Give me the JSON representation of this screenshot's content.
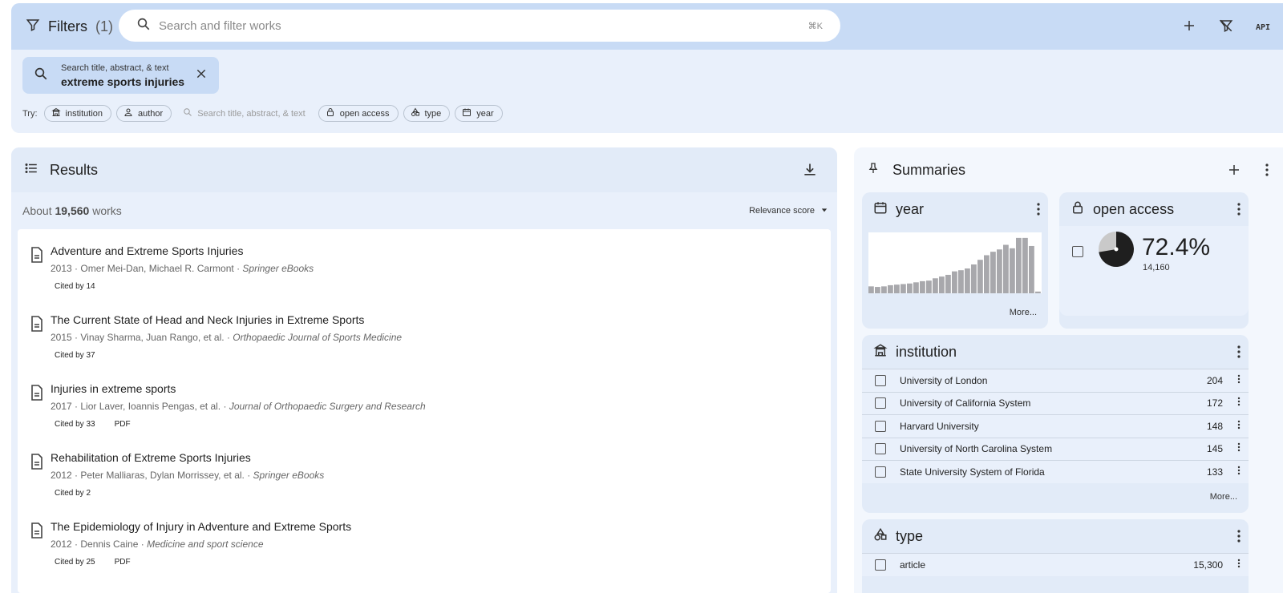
{
  "filters": {
    "title": "Filters",
    "count": "(1)",
    "search_placeholder": "Search and filter works",
    "shortcut": "⌘K",
    "api_label": "API",
    "active_chip": {
      "label": "Search title, abstract, & text",
      "value": "extreme sports injuries"
    },
    "try_label": "Try:",
    "try_chips": [
      "institution",
      "author",
      "Search title, abstract, & text",
      "open access",
      "type",
      "year"
    ]
  },
  "results": {
    "title": "Results",
    "about_prefix": "About",
    "about_count": "19,560",
    "about_suffix": "works",
    "sort_label": "Relevance score",
    "works": [
      {
        "title": "Adventure and Extreme Sports Injuries",
        "year_authors": "2013 · Omer Mei-Dan, Michael R. Carmont ·",
        "source": "Springer eBooks",
        "cited": "Cited by 14",
        "pdf": ""
      },
      {
        "title": "The Current State of Head and Neck Injuries in Extreme Sports",
        "year_authors": "2015 · Vinay Sharma, Juan Rango, et al. ·",
        "source": "Orthopaedic Journal of Sports Medicine",
        "cited": "Cited by 37",
        "pdf": ""
      },
      {
        "title": "Injuries in extreme sports",
        "year_authors": "2017 · Lior Laver, Ioannis Pengas, et al. ·",
        "source": "Journal of Orthopaedic Surgery and Research",
        "cited": "Cited by 33",
        "pdf": "PDF"
      },
      {
        "title": "Rehabilitation of Extreme Sports Injuries",
        "year_authors": "2012 · Peter Malliaras, Dylan Morrissey, et al. ·",
        "source": "Springer eBooks",
        "cited": "Cited by 2",
        "pdf": ""
      },
      {
        "title": "The Epidemiology of Injury in Adventure and Extreme Sports",
        "year_authors": "2012 · Dennis Caine ·",
        "source": "Medicine and sport science",
        "cited": "Cited by 25",
        "pdf": "PDF"
      }
    ]
  },
  "summaries": {
    "title": "Summaries",
    "year": {
      "title": "year",
      "more": "More...",
      "bar_levels": [
        0.12,
        0.11,
        0.12,
        0.14,
        0.15,
        0.16,
        0.17,
        0.19,
        0.21,
        0.22,
        0.26,
        0.29,
        0.32,
        0.38,
        0.4,
        0.43,
        0.5,
        0.58,
        0.66,
        0.72,
        0.76,
        0.84,
        0.78,
        0.96,
        0.96,
        0.82,
        0.03
      ]
    },
    "open_access": {
      "title": "open access",
      "percent": "72.4%",
      "count": "14,160",
      "fraction": 0.724
    },
    "institution": {
      "title": "institution",
      "more": "More...",
      "items": [
        {
          "name": "University of London",
          "count": "204"
        },
        {
          "name": "University of California System",
          "count": "172"
        },
        {
          "name": "Harvard University",
          "count": "148"
        },
        {
          "name": "University of North Carolina System",
          "count": "145"
        },
        {
          "name": "State University System of Florida",
          "count": "133"
        }
      ]
    },
    "type": {
      "title": "type",
      "items": [
        {
          "name": "article",
          "count": "15,300"
        }
      ]
    }
  },
  "colors": {
    "header_bg": "#c8dbf5",
    "panel_bg": "#e9f0fb",
    "bar_color": "#a8a8ac",
    "pie_dark": "#1f1f1f",
    "pie_light": "#c9c9c9"
  }
}
